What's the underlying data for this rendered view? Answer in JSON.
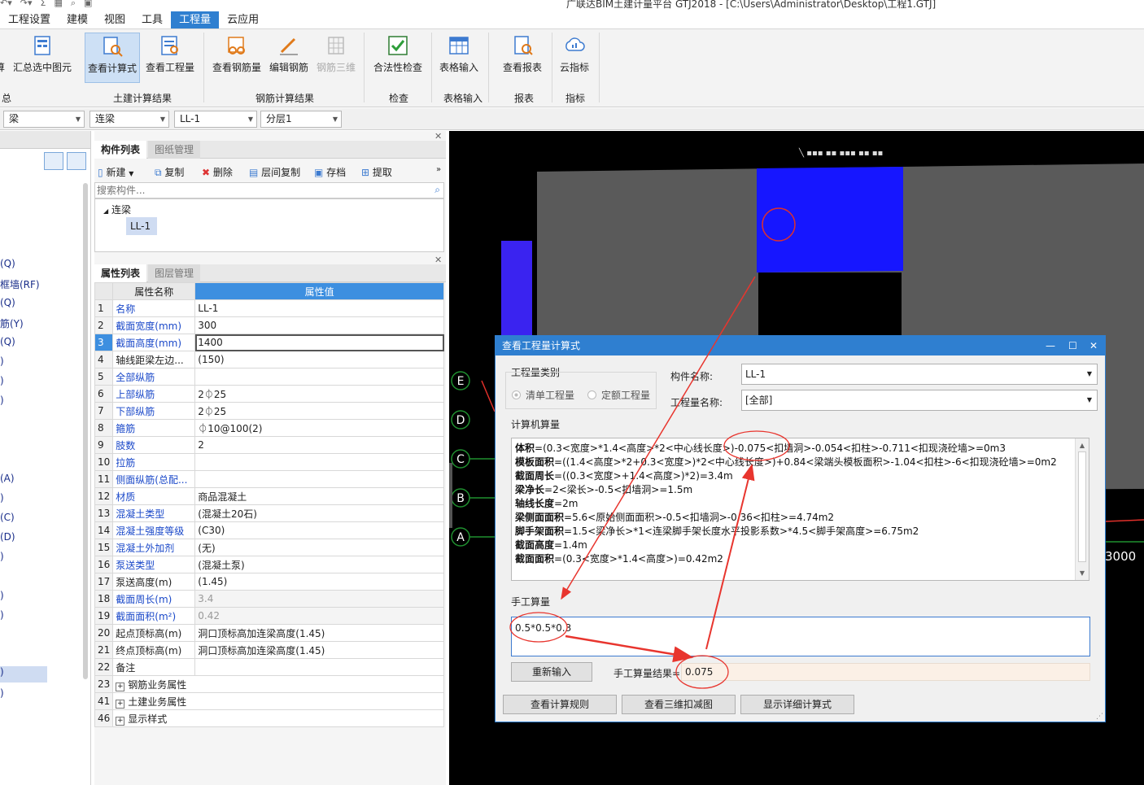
{
  "titlebar": {
    "text": "广联达BIM土建计量平台 GTJ2018 - [C:\\Users\\Administrator\\Desktop\\工程1.GTJ]"
  },
  "menu": {
    "items": [
      "工程设置",
      "建模",
      "视图",
      "工具",
      "工程量",
      "云应用"
    ],
    "active_index": 4
  },
  "ribbon": {
    "buttons": {
      "partial": "算",
      "summary_selected": "汇总选中图元",
      "view_formula": "查看计算式",
      "view_quantity": "查看工程量",
      "view_rebar": "查看钢筋量",
      "edit_rebar": "编辑钢筋",
      "rebar_3d": "钢筋三维",
      "legality_check": "合法性检查",
      "table_input": "表格输入",
      "view_report": "查看报表",
      "cloud_index": "云指标"
    },
    "groups": {
      "summary": "总",
      "civil_result": "土建计算结果",
      "rebar_result": "钢筋计算结果",
      "check": "检查",
      "table": "表格输入",
      "report": "报表",
      "index": "指标"
    }
  },
  "selectors": {
    "type": "梁",
    "subtype": "连梁",
    "component": "LL-1",
    "layer": "分层1"
  },
  "left_tree": {
    "items": [
      "(Q)",
      "框墙(RF)",
      "(Q)",
      "筋(Y)",
      "(Q)",
      ")",
      ")",
      ")",
      "(A)",
      ")",
      "(C)",
      "(D)",
      ")",
      ")",
      ")",
      ")",
      ")"
    ]
  },
  "component_list": {
    "tabs": [
      "构件列表",
      "图纸管理"
    ],
    "toolbar": [
      "新建",
      "复制",
      "删除",
      "层间复制",
      "存档",
      "提取"
    ],
    "search_placeholder": "搜索构件...",
    "tree_root": "连梁",
    "tree_child": "LL-1"
  },
  "property_list": {
    "tabs": [
      "属性列表",
      "图层管理"
    ],
    "header_name": "属性名称",
    "header_value": "属性值",
    "rows": [
      {
        "n": "1",
        "k": "名称",
        "v": "LL-1"
      },
      {
        "n": "2",
        "k": "截面宽度(mm)",
        "v": "300"
      },
      {
        "n": "3",
        "k": "截面高度(mm)",
        "v": "1400"
      },
      {
        "n": "4",
        "k": "轴线距梁左边...",
        "v": "(150)"
      },
      {
        "n": "5",
        "k": "全部纵筋",
        "v": ""
      },
      {
        "n": "6",
        "k": "上部纵筋",
        "v": "2⏀25"
      },
      {
        "n": "7",
        "k": "下部纵筋",
        "v": "2⏀25"
      },
      {
        "n": "8",
        "k": "箍筋",
        "v": "⏀10@100(2)"
      },
      {
        "n": "9",
        "k": "肢数",
        "v": "2"
      },
      {
        "n": "10",
        "k": "拉筋",
        "v": ""
      },
      {
        "n": "11",
        "k": "侧面纵筋(总配...",
        "v": ""
      },
      {
        "n": "12",
        "k": "材质",
        "v": "商品混凝土"
      },
      {
        "n": "13",
        "k": "混凝土类型",
        "v": "(混凝土20石)"
      },
      {
        "n": "14",
        "k": "混凝土强度等级",
        "v": "(C30)"
      },
      {
        "n": "15",
        "k": "混凝土外加剂",
        "v": "(无)"
      },
      {
        "n": "16",
        "k": "泵送类型",
        "v": "(混凝土泵)"
      },
      {
        "n": "17",
        "k": "泵送高度(m)",
        "v": "(1.45)"
      },
      {
        "n": "18",
        "k": "截面周长(m)",
        "v": "3.4"
      },
      {
        "n": "19",
        "k": "截面面积(m²)",
        "v": "0.42"
      },
      {
        "n": "20",
        "k": "起点顶标高(m)",
        "v": "洞口顶标高加连梁高度(1.45)"
      },
      {
        "n": "21",
        "k": "终点顶标高(m)",
        "v": "洞口顶标高加连梁高度(1.45)"
      },
      {
        "n": "22",
        "k": "备注",
        "v": ""
      },
      {
        "n": "23",
        "k": "钢筋业务属性",
        "v": ""
      },
      {
        "n": "41",
        "k": "土建业务属性",
        "v": ""
      },
      {
        "n": "46",
        "k": "显示样式",
        "v": ""
      }
    ]
  },
  "viewport": {
    "axes": [
      "E",
      "D",
      "C",
      "B",
      "A"
    ],
    "dimension": "3000"
  },
  "dialog": {
    "title": "查看工程量计算式",
    "quantity_type_label": "工程量类别",
    "radio_list": "清单工程量",
    "radio_quota": "定额工程量",
    "component_name_label": "构件名称:",
    "component_name_value": "LL-1",
    "quantity_name_label": "工程量名称:",
    "quantity_name_value": "[全部]",
    "computer_calc_label": "计算机算量",
    "calc_lines": [
      {
        "label": "体积",
        "text": "=(0.3<宽度>*1.4<高度>*2<中心线长度>)-0.075<扣墙洞>-0.054<扣柱>-0.711<扣现浇砼墙>=0m3"
      },
      {
        "label": "模板面积",
        "text": "=((1.4<高度>*2+0.3<宽度>)*2<中心线长度>)+0.84<梁端头模板面积>-1.04<扣柱>-6<扣现浇砼墙>=0m2"
      },
      {
        "label": "截面周长",
        "text": "=((0.3<宽度>+1.4<高度>)*2)=3.4m"
      },
      {
        "label": "梁净长",
        "text": "=2<梁长>-0.5<扣墙洞>=1.5m"
      },
      {
        "label": "轴线长度",
        "text": "=2m"
      },
      {
        "label": "梁侧面面积",
        "text": "=5.6<原始侧面面积>-0.5<扣墙洞>-0.36<扣柱>=4.74m2"
      },
      {
        "label": "脚手架面积",
        "text": "=1.5<梁净长>*1<连梁脚手架长度水平投影系数>*4.5<脚手架高度>=6.75m2"
      },
      {
        "label": "截面高度",
        "text": "=1.4m"
      },
      {
        "label": "截面面积",
        "text": "=(0.3<宽度>*1.4<高度>)=0.42m2"
      }
    ],
    "manual_calc_label": "手工算量",
    "manual_input": "0.5*0.5*0.3",
    "reinput_button": "重新输入",
    "manual_result_label": "手工算量结果=",
    "manual_result_value": "0.075",
    "btn_rules": "查看计算规则",
    "btn_3d": "查看三维扣减图",
    "btn_detail": "显示详细计算式"
  }
}
